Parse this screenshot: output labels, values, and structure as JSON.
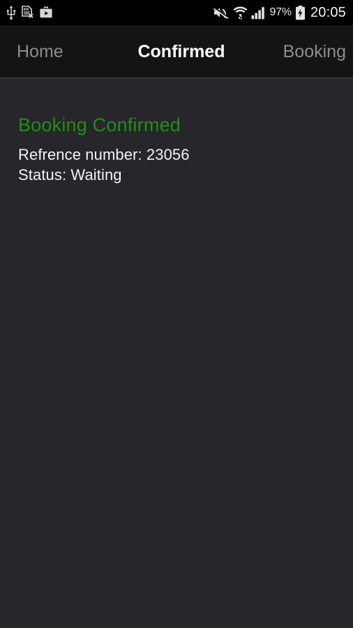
{
  "status_bar": {
    "left_icons": [
      {
        "name": "usb-icon",
        "label": "USB connected"
      },
      {
        "name": "sd-card-removed-icon",
        "label": "SD card removed"
      },
      {
        "name": "play-store-download-icon",
        "label": "Play Store"
      }
    ],
    "right_icons": [
      {
        "name": "volume-mute-icon",
        "label": "Silent mode"
      },
      {
        "name": "wifi-icon",
        "label": "Wi-Fi connected"
      },
      {
        "name": "cellular-signal-icon",
        "label": "Signal strength"
      },
      {
        "name": "battery-charging-icon",
        "label": "Battery charging"
      }
    ],
    "battery_percent": "97%",
    "clock": "20:05"
  },
  "tabs": [
    {
      "label": "Home",
      "active": false
    },
    {
      "label": "Confirmed",
      "active": true
    },
    {
      "label": "Booking",
      "active": false
    }
  ],
  "content": {
    "title": "Booking Confirmed",
    "reference_line": "Refrence number: 23056",
    "status_line": "Status: Waiting"
  },
  "colors": {
    "status_bar_bg": "#000000",
    "tab_bar_bg": "#141414",
    "content_bg": "#26262b",
    "accent_green": "#1f9111",
    "active_tab_text": "#ffffff",
    "inactive_tab_text": "#8d8d8d",
    "body_text": "#f3f3f3"
  }
}
